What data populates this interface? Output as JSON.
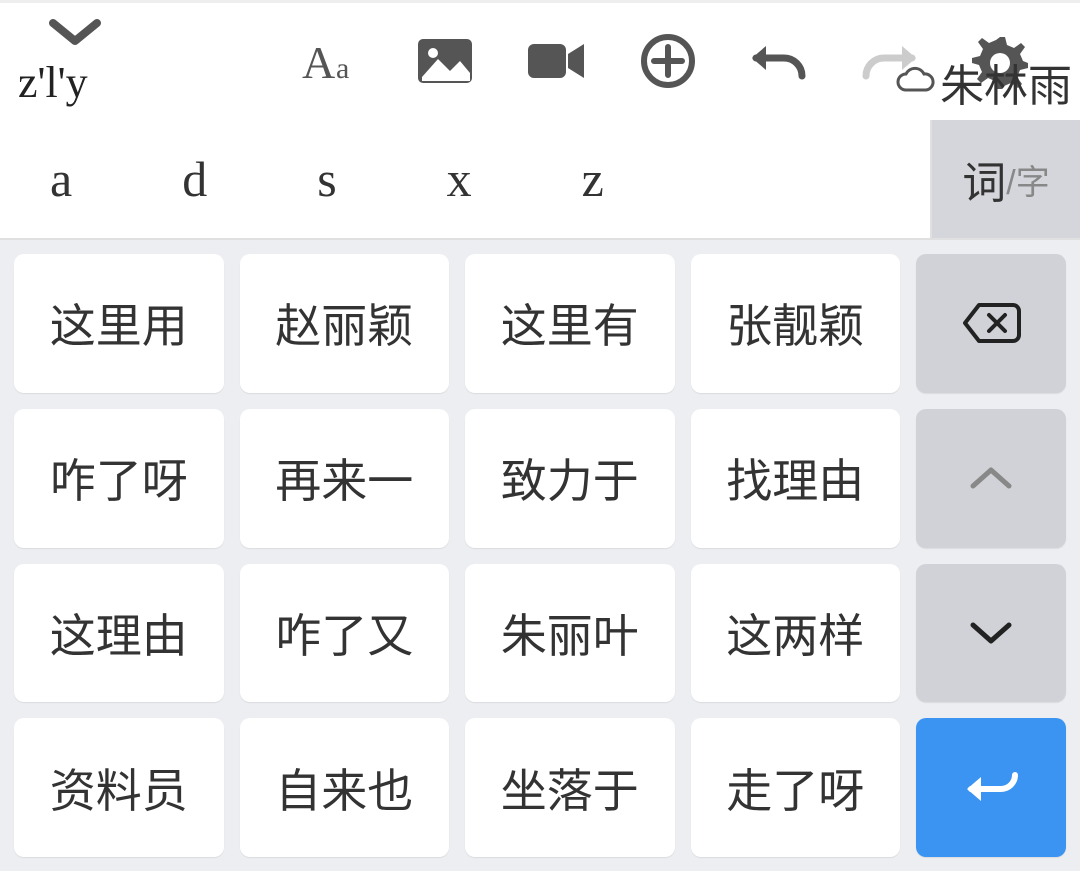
{
  "input_text": "z'l'y",
  "cloud_name": "朱林雨",
  "letters": [
    "a",
    "d",
    "s",
    "x",
    "z"
  ],
  "mode": {
    "main": "词",
    "sub": "/字"
  },
  "candidates": [
    "这里用",
    "赵丽颖",
    "这里有",
    "张靓颖",
    "咋了呀",
    "再来一",
    "致力于",
    "找理由",
    "这理由",
    "咋了又",
    "朱丽叶",
    "这两样",
    "资料员",
    "自来也",
    "坐落于",
    "走了呀"
  ]
}
